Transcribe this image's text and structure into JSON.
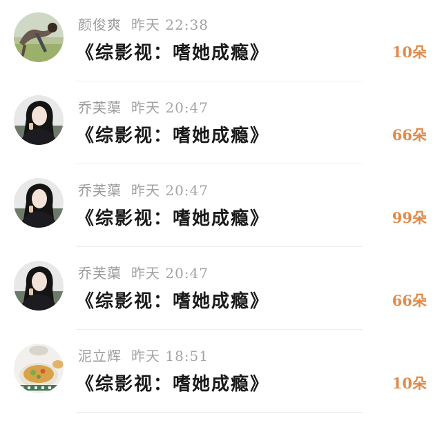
{
  "comments": [
    {
      "name": "颜俊爽",
      "time": "昨天 22:38",
      "title": "《综影视：嗜她成瘾》",
      "count": "10朵",
      "avatar": "landscape-avatar"
    },
    {
      "name": "乔芙蕖",
      "time": "昨天 20:47",
      "title": "《综影视：嗜她成瘾》",
      "count": "66朵",
      "avatar": "portrait-avatar"
    },
    {
      "name": "乔芙蕖",
      "time": "昨天 20:47",
      "title": "《综影视：嗜她成瘾》",
      "count": "99朵",
      "avatar": "portrait-avatar"
    },
    {
      "name": "乔芙蕖",
      "time": "昨天 20:47",
      "title": "《综影视：嗜她成瘾》",
      "count": "66朵",
      "avatar": "portrait-avatar"
    },
    {
      "name": "泥立辉",
      "time": "昨天 18:51",
      "title": "《综影视：嗜她成瘾》",
      "count": "10朵",
      "avatar": "food-avatar"
    }
  ],
  "colors": {
    "name": "#9a9a9a",
    "title": "#1a1a1a",
    "count": "#e08a4a",
    "divider": "#ededed"
  }
}
